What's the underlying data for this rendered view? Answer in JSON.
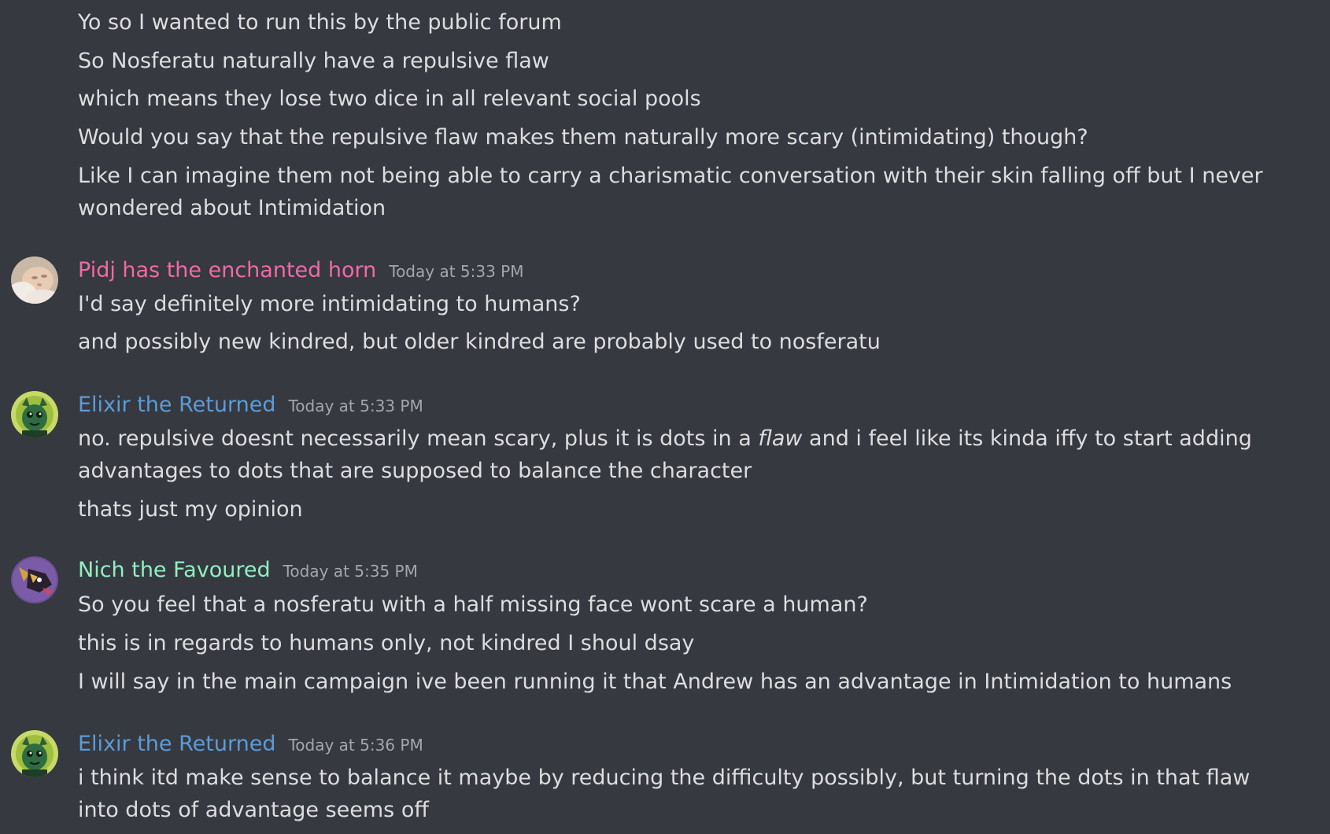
{
  "colors": {
    "background": "#36393f",
    "text": "#dcddde",
    "timestamp": "#a3a6aa",
    "pidj": "#f06aa6",
    "elixir": "#5b9bd8",
    "nich": "#8ff0c0"
  },
  "intro_messages": [
    "Yo so I wanted to run this by the public forum",
    "So Nosferatu naturally have a repulsive flaw",
    "which means they lose two dice in all relevant social pools",
    "Would you say that the repulsive flaw makes them naturally more scary (intimidating) though?",
    "Like I can imagine them not being able to carry a charismatic conversation with their skin falling off but I never wondered about Intimidation"
  ],
  "groups": [
    {
      "author": "Pidj has the enchanted horn",
      "timestamp": "Today at 5:33 PM",
      "avatar_icon": "baby-photo-avatar-icon",
      "messages": [
        "I'd say definitely more intimidating to humans?",
        "and possibly new kindred, but older kindred are probably used to nosferatu"
      ]
    },
    {
      "author": "Elixir the Returned",
      "timestamp": "Today at 5:33 PM",
      "avatar_icon": "green-creature-avatar-icon",
      "messages": [
        {
          "before": "no. repulsive doesnt necessarily mean scary, plus it is dots in a ",
          "emphasis": "flaw",
          "after": " and i feel like its kinda iffy to start adding advantages to dots that are supposed to balance the character"
        },
        "thats just my opinion"
      ]
    },
    {
      "author": "Nich the Favoured",
      "timestamp": "Today at 5:35 PM",
      "avatar_icon": "purple-fox-avatar-icon",
      "messages": [
        "So you feel that a nosferatu with a half missing face wont scare a human?",
        "this is in regards to humans only, not kindred I shoul dsay",
        "I will say in the main campaign ive been running it that Andrew has an advantage in Intimidation to humans"
      ]
    },
    {
      "author": "Elixir the Returned",
      "timestamp": "Today at 5:36 PM",
      "avatar_icon": "green-creature-avatar-icon",
      "messages": [
        "i think itd make sense to balance it maybe by reducing the difficulty possibly, but turning the dots in that flaw into dots of advantage seems off"
      ]
    }
  ]
}
